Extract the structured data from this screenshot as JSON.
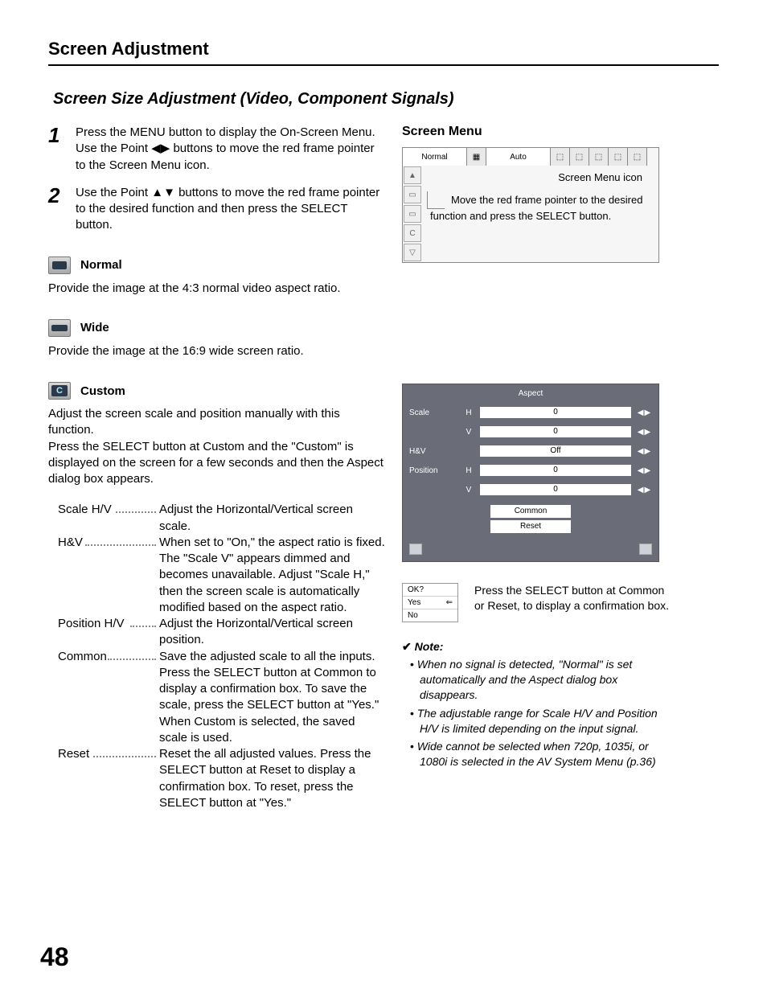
{
  "header": "Screen Adjustment",
  "subhead": "Screen Size Adjustment (Video, Component Signals)",
  "steps": [
    {
      "num": "1",
      "text": "Press the MENU button to display the On-Screen Menu. Use the Point ◀▶ buttons to move the red frame pointer to the Screen Menu icon."
    },
    {
      "num": "2",
      "text": "Use the Point ▲▼ buttons to move the red frame pointer to the desired function and then press the SELECT button."
    }
  ],
  "modes": {
    "normal": {
      "title": "Normal",
      "desc": "Provide the image at the 4:3 normal video aspect ratio."
    },
    "wide": {
      "title": "Wide",
      "desc": "Provide the image at the 16:9 wide screen ratio."
    },
    "custom": {
      "title": "Custom",
      "desc": "Adjust the screen scale and position manually with this function.\nPress the SELECT button at Custom and the \"Custom\" is displayed on the screen for a few seconds and then the Aspect dialog box appears."
    }
  },
  "defs": [
    {
      "label": "Scale H/V",
      "text": "Adjust the Horizontal/Vertical screen scale."
    },
    {
      "label": "H&V",
      "text": "When set to \"On,\" the aspect ratio is fixed. The \"Scale V\" appears dimmed and becomes unavailable. Adjust \"Scale H,\" then the screen scale is automatically modified based on the aspect ratio."
    },
    {
      "label": "Position H/V",
      "text": "Adjust the Horizontal/Vertical screen position."
    },
    {
      "label": "Common",
      "text": "Save the adjusted scale to all the inputs. Press the SELECT button at Common to display a confirmation box. To save the scale, press the SELECT button at \"Yes.\" When Custom is selected, the saved scale is used."
    },
    {
      "label": "Reset",
      "text": "Reset the all adjusted values. Press the SELECT button at Reset to display a confirmation box. To reset, press the SELECT button at \"Yes.\""
    }
  ],
  "right": {
    "title": "Screen Menu",
    "top_normal": "Normal",
    "top_auto": "Auto",
    "icon_label": "Screen Menu icon",
    "pointer_text": "Move the red frame pointer to the desired function and press the SELECT button."
  },
  "aspect": {
    "title": "Aspect",
    "rows": {
      "scale": "Scale",
      "hv": "H&V",
      "position": "Position"
    },
    "sub_h": "H",
    "sub_v": "V",
    "val_zero": "0",
    "val_off": "Off",
    "common": "Common",
    "reset": "Reset"
  },
  "okbox": {
    "ok": "OK?",
    "yes": "Yes",
    "no": "No"
  },
  "ok_text": "Press the SELECT button at Common or Reset, to display a confirmation box.",
  "note": {
    "head": "Note:",
    "items": [
      "When no signal is detected, \"Normal\" is set automatically and the Aspect dialog box disappears.",
      "The adjustable range for Scale H/V and Position H/V is limited depending on the input signal.",
      "Wide cannot be selected when 720p, 1035i, or 1080i is selected in the AV System Menu (p.36)"
    ]
  },
  "page_number": "48"
}
